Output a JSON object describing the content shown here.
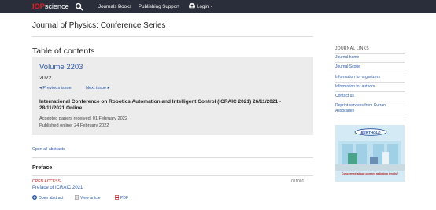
{
  "nav": {
    "logo_iop": "IOP",
    "logo_science": "science",
    "journals_label": "Journals",
    "books_label": "Books",
    "publishing_support_label": "Publishing Support",
    "login_label": "Login",
    "bg_color": "#2a2d3a",
    "logo_color": "#e0202a"
  },
  "journal_title": "Journal of Physics: Conference Series",
  "toc_heading": "Table of contents",
  "volume": {
    "title": "Volume 2203",
    "year": "2022",
    "previous_label": "◂ Previous issue",
    "next_label": "Next issue ▸",
    "conference_title": "International Conference on Robotics Automation and Intelligent Control (ICRAIC 2021) 26/11/2021 - 28/11/2021 Online",
    "accepted": "Accepted papers received: 01 February 2022",
    "published": "Published online: 24 February 2022"
  },
  "open_all_abstracts": "Open all abstracts",
  "section_heading": "Preface",
  "article": {
    "access": "OPEN ACCESS",
    "number": "011001",
    "title": "Preface of ICRAIC 2021",
    "open_abstract_label": "Open abstract",
    "view_article_label": "View article",
    "pdf_label": "PDF"
  },
  "sidebar": {
    "heading": "JOURNAL LINKS",
    "links": [
      "Journal home",
      "Journal Scope",
      "Information for organizers",
      "Information for authors",
      "Contact us",
      "Reprint services from Curran Associates"
    ]
  },
  "ad": {
    "brand": "BERTHOLD",
    "caption": "Concerned about current radiation levels?"
  },
  "colors": {
    "link": "#2d5aa6",
    "accent_red": "#c0201e",
    "panel": "#ececec"
  },
  "icons": [
    "search-icon",
    "user-icon",
    "chevron-down-icon",
    "plus-icon",
    "document-icon",
    "pdf-icon"
  ]
}
